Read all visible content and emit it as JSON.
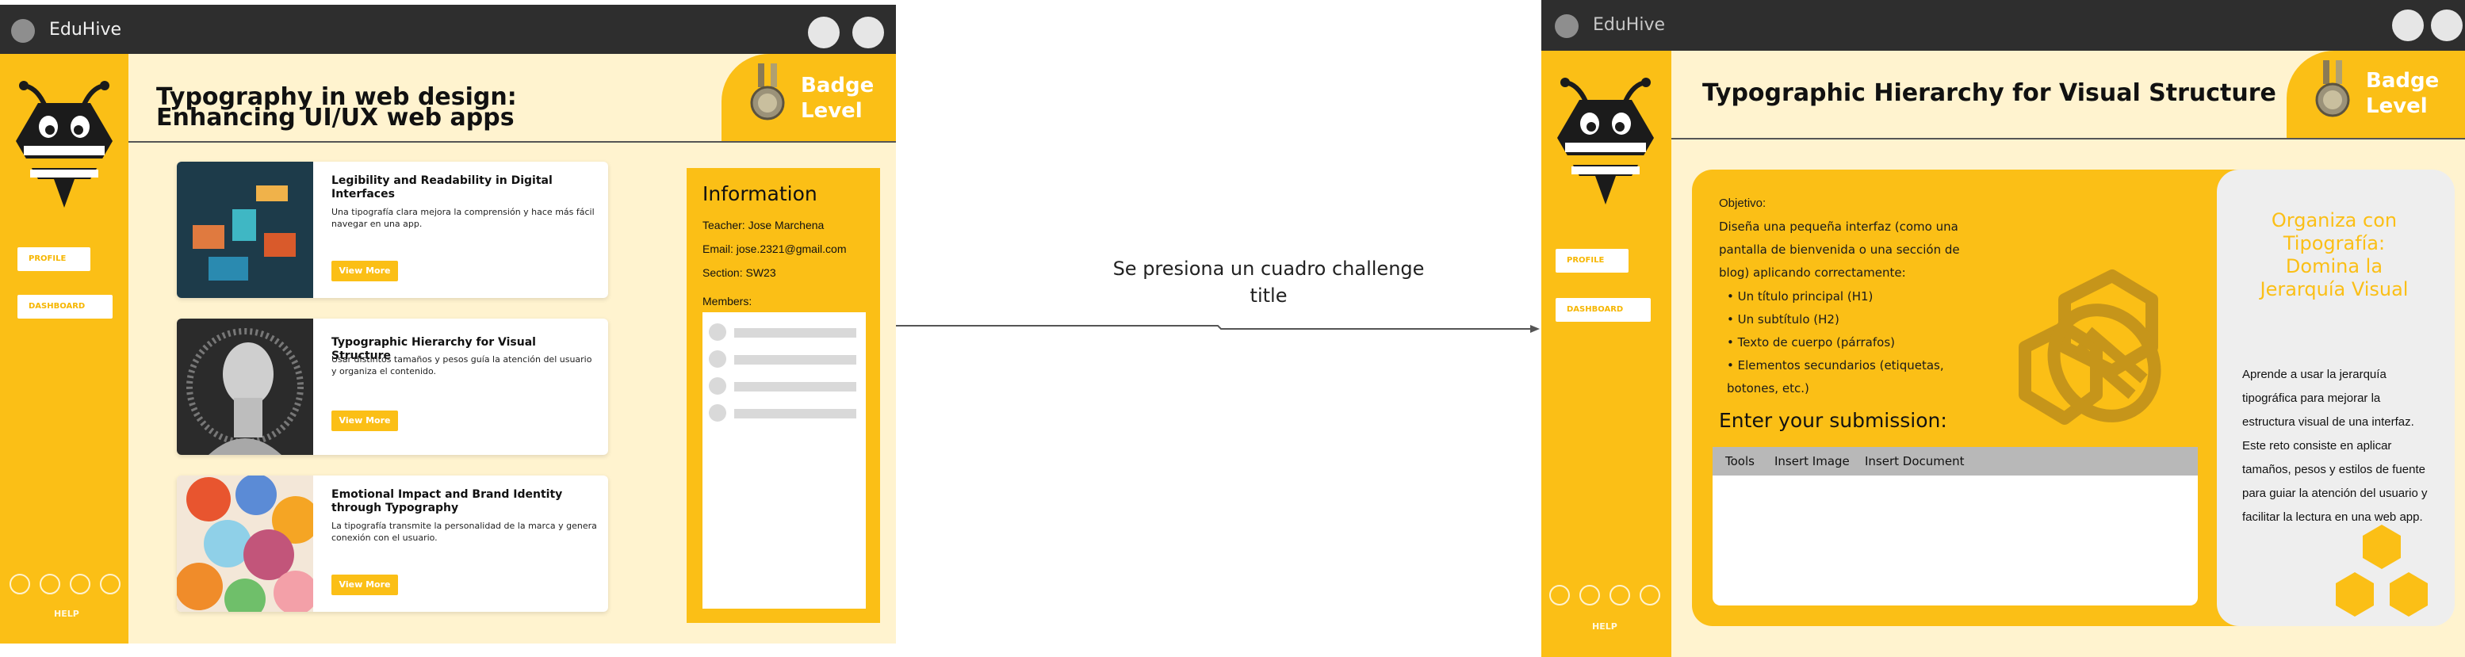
{
  "left_window": {
    "app_name": "EduHive",
    "page_title": "Typography in web design: Enhancing UI/UX web apps",
    "badge": "Badge Level",
    "sidebar": {
      "profile": "PROFILE",
      "dashboard": "DASHBOARD",
      "help": "HELP",
      "social_icons": [
        "facebook-icon",
        "instagram-icon",
        "twitter-icon",
        "email-icon"
      ]
    },
    "challenges": [
      {
        "title": "Legibility and Readability in Digital Interfaces",
        "desc": "Una tipografía clara mejora la comprensión y hace más fácil navegar en una app.",
        "button": "View More"
      },
      {
        "title": "Typographic Hierarchy for Visual Structure",
        "desc": "Usar distintos tamaños y pesos guía la atención del usuario y organiza el contenido.",
        "button": "View More"
      },
      {
        "title": "Emotional Impact and Brand Identity through Typography",
        "desc": "La tipografía transmite la personalidad de la marca y genera conexión con el usuario.",
        "button": "View More"
      }
    ],
    "info": {
      "heading": "Information",
      "teacher": "Teacher: Jose Marchena",
      "email": "Email: jose.2321@gmail.com",
      "section": "Section: SW23",
      "members": "Members:"
    }
  },
  "arrow_label": "Se presiona un cuadro challenge title",
  "right_window": {
    "app_name": "EduHive",
    "page_title": "Typographic Hierarchy for Visual Structure",
    "badge": "Badge Level",
    "sidebar": {
      "profile": "PROFILE",
      "dashboard": "DASHBOARD",
      "help": "HELP"
    },
    "objective": {
      "label": "Objetivo:",
      "intro": "Diseña una pequeña interfaz (como una pantalla de bienvenida o una sección de blog) aplicando correctamente:",
      "items": [
        "Un título principal (H1)",
        "Un subtítulo (H2)",
        "Texto de cuerpo (párrafos)",
        "Elementos secundarios (etiquetas, botones, etc.)"
      ]
    },
    "submission": {
      "heading": "Enter your submission:",
      "tools": "Tools",
      "insert_image": "Insert Image",
      "insert_document": "Insert Document"
    },
    "side_panel": {
      "title": "Organiza con Tipografía: Domina la Jerarquía Visual",
      "body": "Aprende a usar la jerarquía tipográfica para mejorar la estructura visual de una interfaz. Este reto consiste en aplicar tamaños, pesos y estilos de fuente para guiar la atención del usuario y facilitar la lectura en una web app."
    }
  },
  "colors": {
    "accent": "#fbbf16",
    "background": "#fff3cf",
    "titlebar": "#2e2e2e"
  }
}
